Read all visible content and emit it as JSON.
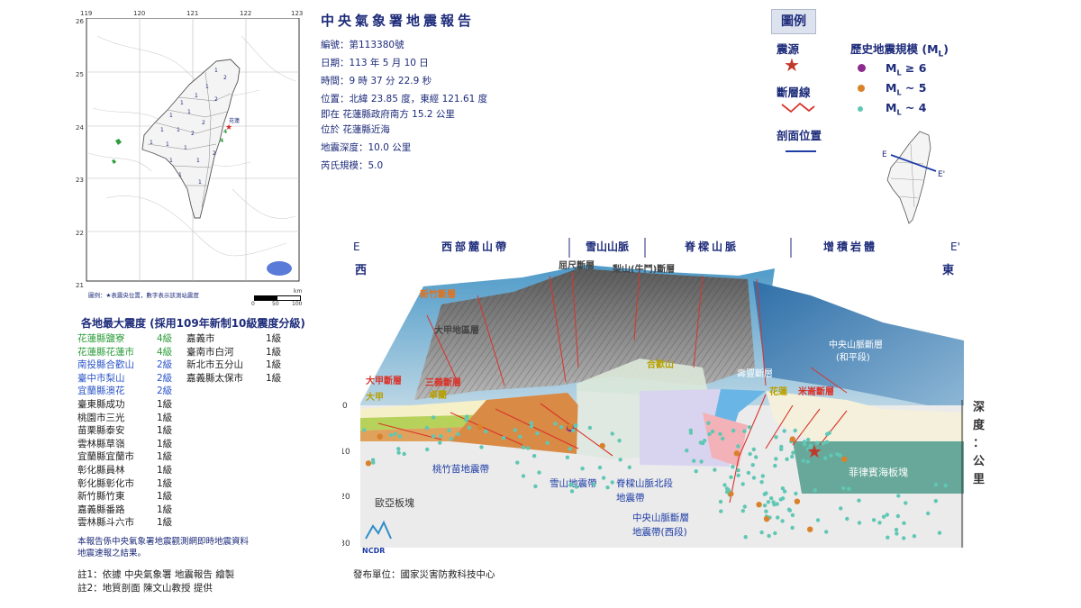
{
  "map": {
    "lon_ticks": [
      "119",
      "120",
      "121",
      "122",
      "123"
    ],
    "lat_ticks": [
      "26",
      "25",
      "24",
      "23",
      "22",
      "21"
    ],
    "caption": "圖例：★表震央位置，數字表示該測站震度",
    "scale_labels": [
      "0",
      "50",
      "100"
    ],
    "scale_unit": "km",
    "epicenter_label": "花蓮"
  },
  "report": {
    "title": "中央氣象署地震報告",
    "number_label": "編號：",
    "number": "第113380號",
    "date_label": "日期：",
    "date": "113 年 5 月 10 日",
    "time_label": "時間：",
    "time": "9 時 37 分 22.9 秒",
    "location_label": "位置：",
    "location": "北緯 23.85 度，東經 121.61 度",
    "location_line2": "即在 花蓮縣政府南方 15.2 公里",
    "location_line3": "位於 花蓮縣近海",
    "depth_label": "地震深度：",
    "depth": "10.0 公里",
    "magnitude_label": "芮氏規模：",
    "magnitude": "5.0"
  },
  "legend": {
    "title": "圖例",
    "epicenter": "震源",
    "fault_line": "斷層線",
    "profile_position": "剖面位置",
    "history_title": "歷史地震規模 (M",
    "history_title_sub": "L",
    "history_title_end": ")",
    "mag_items": [
      {
        "label": "≥ 6",
        "color": "#8b2b8e"
      },
      {
        "label": "~ 5",
        "color": "#d9822b"
      },
      {
        "label": "~ 4",
        "color": "#5fc7b4"
      }
    ],
    "profile_e": "E",
    "profile_e2": "E'",
    "colors": {
      "epicenter": "#c0392b",
      "fault": "#d9342b",
      "profile": "#1d3ca6"
    }
  },
  "intensity": {
    "title": "各地最大震度 (採用109年新制10級震度分級)",
    "col1": [
      {
        "place": "花蓮縣鹽寮",
        "level": "4級",
        "color": "#2e9e3c"
      },
      {
        "place": "花蓮縣花蓮市",
        "level": "4級",
        "color": "#2e9e3c"
      },
      {
        "place": "南投縣合歡山",
        "level": "2級",
        "color": "#2c56c9"
      },
      {
        "place": "臺中市梨山",
        "level": "2級",
        "color": "#2c56c9"
      },
      {
        "place": "宜蘭縣澳花",
        "level": "2級",
        "color": "#2c56c9"
      },
      {
        "place": "臺東縣成功",
        "level": "1級",
        "color": "#222222"
      },
      {
        "place": "桃園市三光",
        "level": "1級",
        "color": "#222222"
      },
      {
        "place": "苗栗縣泰安",
        "level": "1級",
        "color": "#222222"
      },
      {
        "place": "雲林縣草嶺",
        "level": "1級",
        "color": "#222222"
      },
      {
        "place": "宜蘭縣宜蘭市",
        "level": "1級",
        "color": "#222222"
      },
      {
        "place": "彰化縣員林",
        "level": "1級",
        "color": "#222222"
      },
      {
        "place": "彰化縣彰化市",
        "level": "1級",
        "color": "#222222"
      },
      {
        "place": "新竹縣竹東",
        "level": "1級",
        "color": "#222222"
      },
      {
        "place": "嘉義縣番路",
        "level": "1級",
        "color": "#222222"
      },
      {
        "place": "雲林縣斗六市",
        "level": "1級",
        "color": "#222222"
      }
    ],
    "col2": [
      {
        "place": "嘉義市",
        "level": "1級",
        "color": "#222222"
      },
      {
        "place": "臺南市白河",
        "level": "1級",
        "color": "#222222"
      },
      {
        "place": "新北市五分山",
        "level": "1級",
        "color": "#222222"
      },
      {
        "place": "嘉義縣太保市",
        "level": "1級",
        "color": "#222222"
      }
    ],
    "remark_line1": "本報告係中央氣象署地震觀測網即時地震資料",
    "remark_line2": "地震速報之結果。"
  },
  "notes": {
    "note1": "註1：依據 中央氣象署 地震報告 繪製",
    "note2": "註2：地質剖面 陳文山教授 提供",
    "publisher": "發布單位：國家災害防救科技中心"
  },
  "section": {
    "e_left": "E",
    "e_right": "E'",
    "west": "西",
    "east": "東",
    "zones": [
      "西部麓山帶",
      "雪山山脈",
      "脊樑山脈",
      "增積岩體"
    ],
    "depth_title": [
      "深",
      "度",
      "：",
      "公",
      "里"
    ],
    "depth_ticks": [
      "0",
      "-10",
      "-20",
      "-30"
    ],
    "surface_labels": {
      "hsinchu_fault": "新竹斷層",
      "dadu": "大甲地區層",
      "qushan": "屈尺斷層",
      "lishan": "梨山(牛鬥)斷層",
      "dajia_fault": "大甲斷層",
      "dajia": "大甲",
      "sanyi": "三義斷層",
      "zhuolan": "卓蘭",
      "hehuan": "合歡山",
      "central_fault": "中央山脈斷層",
      "central_fault_sub": "(和平段)",
      "hualien": "花蓮",
      "milun": "米崙斷層",
      "shoufeng": "壽豐斷層"
    },
    "depth_labels": {
      "taomiao": "桃竹苗地震帶",
      "xueshan": "雪山地震帶",
      "spine_north": "脊樑山脈北段",
      "spine_north2": "地震帶",
      "central_fault": "中央山脈斷層",
      "central_fault2": "地震帶(西段)",
      "eurasian": "歐亞板塊",
      "philippine": "菲律賓海板塊"
    },
    "logo": "NCDR"
  }
}
